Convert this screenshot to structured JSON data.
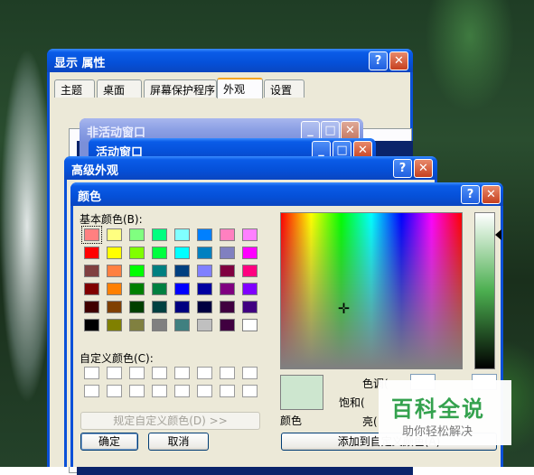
{
  "display_props": {
    "title": "显示 属性",
    "tabs": [
      "主题",
      "桌面",
      "屏幕保护程序",
      "外观",
      "设置"
    ],
    "preview": {
      "inactive_title": "非活动窗口",
      "active_title": "活动窗口"
    }
  },
  "advanced": {
    "title": "高级外观"
  },
  "color_dialog": {
    "title": "颜色",
    "basic_label": "基本颜色(B):",
    "custom_label": "自定义颜色(C):",
    "define_custom": "规定自定义颜色(D) >>",
    "ok": "确定",
    "cancel": "取消",
    "color_solid_label": "颜色",
    "hue_label": "色调(",
    "sat_label": "饱和(",
    "lum_label": "亮(",
    "add_custom": "添加到自定义颜色(A)",
    "current_color": "#cde6cf",
    "basic_colors": [
      [
        "#ff8080",
        "#ffff80",
        "#80ff80",
        "#00ff80",
        "#80ffff",
        "#0080ff",
        "#ff80c0",
        "#ff80ff"
      ],
      [
        "#ff0000",
        "#ffff00",
        "#80ff00",
        "#00ff40",
        "#00ffff",
        "#0080c0",
        "#8080c0",
        "#ff00ff"
      ],
      [
        "#804040",
        "#ff8040",
        "#00ff00",
        "#008080",
        "#004080",
        "#8080ff",
        "#800040",
        "#ff0080"
      ],
      [
        "#800000",
        "#ff8000",
        "#008000",
        "#008040",
        "#0000ff",
        "#0000a0",
        "#800080",
        "#8000ff"
      ],
      [
        "#400000",
        "#804000",
        "#004000",
        "#004040",
        "#000080",
        "#000040",
        "#400040",
        "#400080"
      ],
      [
        "#000000",
        "#808000",
        "#808040",
        "#808080",
        "#408080",
        "#c0c0c0",
        "#400040",
        "#ffffff"
      ]
    ]
  },
  "watermark": {
    "main": "百科全说",
    "sub": "助你轻松解决"
  }
}
